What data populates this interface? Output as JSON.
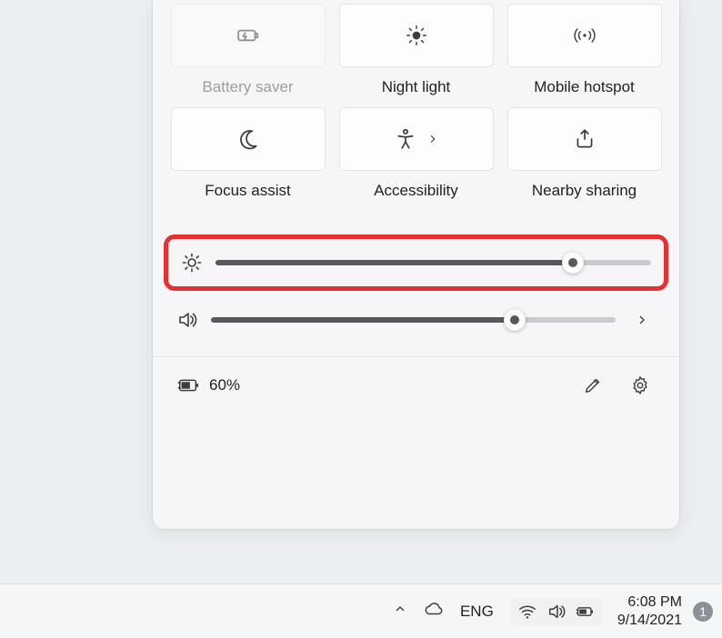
{
  "quick_settings": {
    "tiles": [
      {
        "id": "battery-saver",
        "label": "Battery saver",
        "enabled": false
      },
      {
        "id": "night-light",
        "label": "Night light",
        "enabled": true
      },
      {
        "id": "mobile-hotspot",
        "label": "Mobile hotspot",
        "enabled": true
      },
      {
        "id": "focus-assist",
        "label": "Focus assist",
        "enabled": true
      },
      {
        "id": "accessibility",
        "label": "Accessibility",
        "enabled": true,
        "has_chevron": true
      },
      {
        "id": "nearby-sharing",
        "label": "Nearby sharing",
        "enabled": true
      }
    ],
    "brightness": {
      "value_percent": 82
    },
    "volume": {
      "value_percent": 75
    },
    "battery": {
      "percent_label": "60%"
    }
  },
  "taskbar": {
    "language": "ENG",
    "time": "6:08 PM",
    "date": "9/14/2021",
    "notification_count": "1"
  },
  "annotation": {
    "highlight": "brightness-slider"
  }
}
